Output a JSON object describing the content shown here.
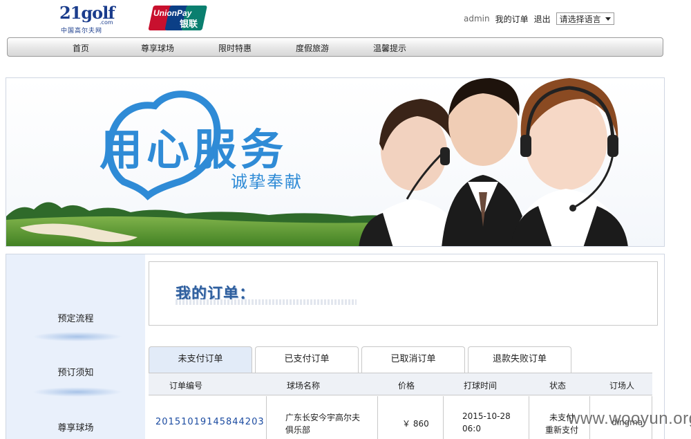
{
  "brand": {
    "logo_number": "21golf",
    "logo_com": ".com",
    "logo_tagline": "中国高尔夫网",
    "unionpay_en": "UnionPay",
    "unionpay_cn": "银联"
  },
  "userbar": {
    "username": "admin",
    "my_orders": "我的订单",
    "logout": "退出",
    "language_select": "请选择语言"
  },
  "nav": {
    "items": [
      "首页",
      "尊享球场",
      "限时特惠",
      "度假旅游",
      "温馨提示"
    ]
  },
  "banner": {
    "slogan_main": "用心服务",
    "slogan_sub": "诚挚奉献"
  },
  "sidebar": {
    "items": [
      "预定流程",
      "预订须知",
      "尊享球场"
    ]
  },
  "page": {
    "title": "我的订单："
  },
  "tabs": [
    "未支付订单",
    "已支付订单",
    "已取消订单",
    "退款失败订单"
  ],
  "table": {
    "columns": [
      "订单编号",
      "球场名称",
      "价格",
      "打球时间",
      "状态",
      "订场人"
    ],
    "rows": [
      {
        "order_no": "20151019145844203",
        "course_line1": "广东长安今宇高尔夫",
        "course_line2": "俱乐部",
        "price": "￥ 860",
        "time_line1": "2015-10-28",
        "time_line2": "06:0",
        "status_line1": "未支付",
        "status_line2": "重新支付",
        "booker": "dingma"
      }
    ]
  },
  "watermark": "www.wooyun.org",
  "colors": {
    "accent_blue": "#2f8bd6",
    "link_blue": "#1a4aa0",
    "sidebar_bg": "#e9f0fb",
    "active_tab_bg": "#e2ebf8",
    "unionpay_red": "#c8102e"
  }
}
